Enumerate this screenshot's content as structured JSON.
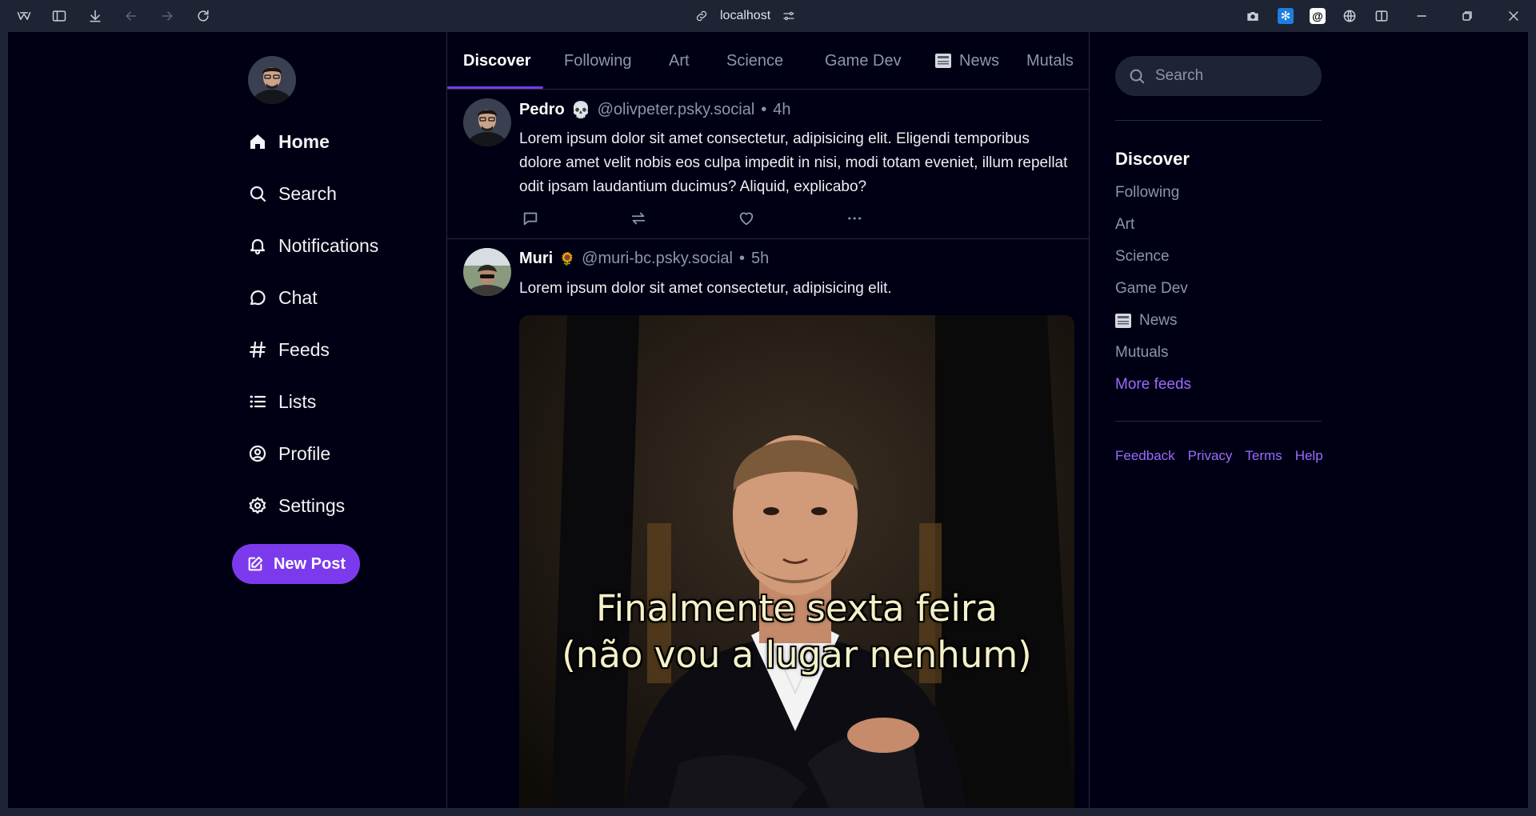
{
  "browser": {
    "url": "localhost",
    "icons": [
      "browser-logo-icon",
      "sidebar-toggle-icon",
      "download-icon",
      "back-icon",
      "forward-icon",
      "reload-icon",
      "link-icon",
      "site-settings-icon",
      "screenshot-icon",
      "extension-icon",
      "extension-icon",
      "globe-icon",
      "split-view-icon",
      "minimize-icon",
      "restore-icon",
      "close-icon"
    ]
  },
  "nav": {
    "items": [
      {
        "label": "Home",
        "icon": "home-icon"
      },
      {
        "label": "Search",
        "icon": "search-icon"
      },
      {
        "label": "Notifications",
        "icon": "bell-icon"
      },
      {
        "label": "Chat",
        "icon": "chat-bubble-icon"
      },
      {
        "label": "Feeds",
        "icon": "hash-icon"
      },
      {
        "label": "Lists",
        "icon": "list-icon"
      },
      {
        "label": "Profile",
        "icon": "user-circle-icon"
      },
      {
        "label": "Settings",
        "icon": "gear-icon"
      }
    ],
    "new_post": "New Post"
  },
  "tabs": [
    "Discover",
    "Following",
    "Art",
    "Science",
    "Game Dev",
    "News",
    "Mutals"
  ],
  "posts": [
    {
      "name": "Pedro",
      "emoji": "💀",
      "handle": "@olivpeter.psky.social",
      "dot": "•",
      "time": "4h",
      "text": "Lorem ipsum dolor sit amet consectetur, adipisicing elit. Eligendi temporibus dolore amet velit nobis eos culpa impedit in nisi, modi totam eveniet, illum repellat odit ipsam laudantium ducimus? Aliquid, explicabo?"
    },
    {
      "name": "Muri",
      "emoji": "🌻",
      "handle": "@muri-bc.psky.social",
      "dot": "•",
      "time": "5h",
      "text": "Lorem ipsum dolor sit amet consectetur, adipisicing elit.",
      "image_caption_line1": "Finalmente sexta feira",
      "image_caption_line2": "(não vou a lugar nenhum)"
    }
  ],
  "right": {
    "search_placeholder": "Search",
    "feeds_heading": "Discover",
    "feeds": [
      "Following",
      "Art",
      "Science",
      "Game Dev",
      "News",
      "Mutuals"
    ],
    "more_feeds": "More feeds",
    "footer": [
      "Feedback",
      "Privacy",
      "Terms",
      "Help"
    ]
  },
  "colors": {
    "accent": "#7c3aed",
    "link": "#9b6bff",
    "background": "#000014",
    "muted": "#8e95a8"
  }
}
